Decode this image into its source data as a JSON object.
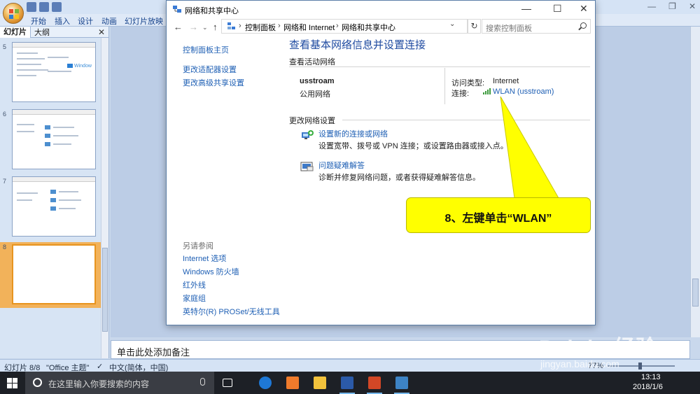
{
  "ppt": {
    "ribbon_tabs": [
      "开始",
      "插入",
      "设计",
      "动画",
      "幻灯片放映"
    ],
    "left_tabs": {
      "slides": "幻灯片",
      "outline": "大纲"
    },
    "slide_numbers": [
      "5",
      "6",
      "7",
      "8"
    ],
    "thumb_label": "Window",
    "notes_placeholder": "单击此处添加备注",
    "status": {
      "slide": "幻灯片 8/8",
      "theme": "\"Office 主题\"",
      "language": "中文(简体，中国)",
      "zoom": "77%"
    }
  },
  "window": {
    "title": "网络和共享中心",
    "breadcrumbs": [
      "控制面板",
      "网络和 Internet",
      "网络和共享中心"
    ],
    "search_placeholder": "搜索控制面板",
    "left_nav": [
      "控制面板主页",
      "更改适配器设置",
      "更改高级共享设置"
    ],
    "see_also_title": "另请参阅",
    "see_also": [
      "Internet 选项",
      "Windows 防火墙",
      "红外线",
      "家庭组",
      "英特尔(R) PROSet/无线工具"
    ],
    "main_title": "查看基本网络信息并设置连接",
    "active_section": "查看活动网络",
    "network_name": "usstroam",
    "network_type": "公用网络",
    "access_type_label": "访问类型:",
    "access_type_value": "Internet",
    "connection_label": "连接:",
    "connection_value": "WLAN (usstroam)",
    "change_section": "更改网络设置",
    "tasks": [
      {
        "title": "设置新的连接或网络",
        "desc": "设置宽带、拨号或 VPN 连接；或设置路由器或接入点。"
      },
      {
        "title": "问题疑难解答",
        "desc": "诊断并修复网络问题，或者获得疑难解答信息。"
      }
    ]
  },
  "annotation": {
    "text": "8、左键单击“WLAN”",
    "color": "#ffff00"
  },
  "taskbar": {
    "search_text": "在这里输入你要搜索的内容",
    "ime": "英",
    "time": "13:13",
    "date": "2018/1/6",
    "notifications": "2"
  },
  "watermark": {
    "brand": "Bai du 经验",
    "url": "jingyan.baidu.com"
  }
}
